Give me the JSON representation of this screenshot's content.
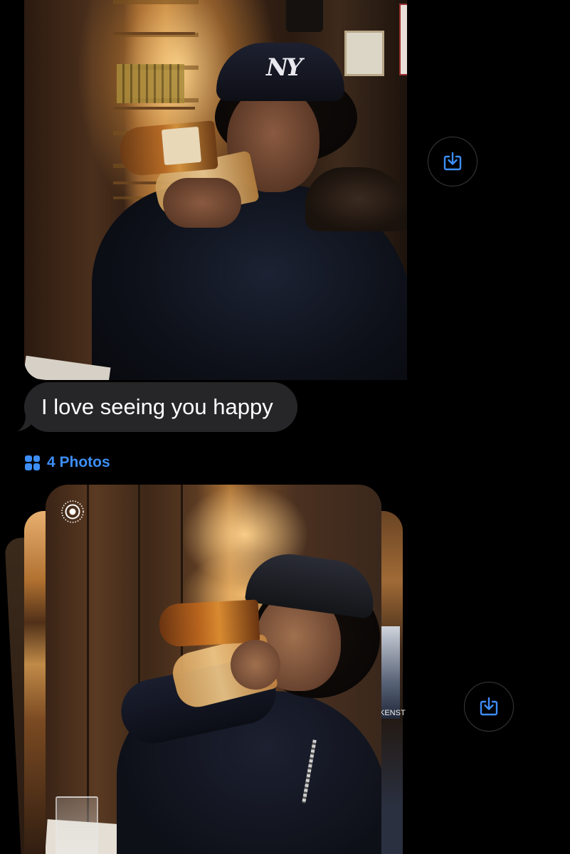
{
  "conversation": {
    "messages": [
      {
        "type": "photo",
        "description_key": "photo-1"
      },
      {
        "type": "text",
        "text": "I love seeing you happy"
      },
      {
        "type": "photo-stack",
        "label": "4 Photos"
      }
    ]
  },
  "bubble": {
    "text": "I love seeing you happy"
  },
  "photo_stack": {
    "label": "4 Photos"
  },
  "photo2_partial_text": "KENST",
  "photo1_cap_logo": "NY",
  "icons": {
    "save": "save-to-photos-icon",
    "stack": "photo-grid-icon",
    "live": "live-photo-icon"
  },
  "colors": {
    "background": "#000000",
    "bubble": "#262628",
    "accent": "#3d8ef7",
    "save_border": "#3a3a3c"
  }
}
